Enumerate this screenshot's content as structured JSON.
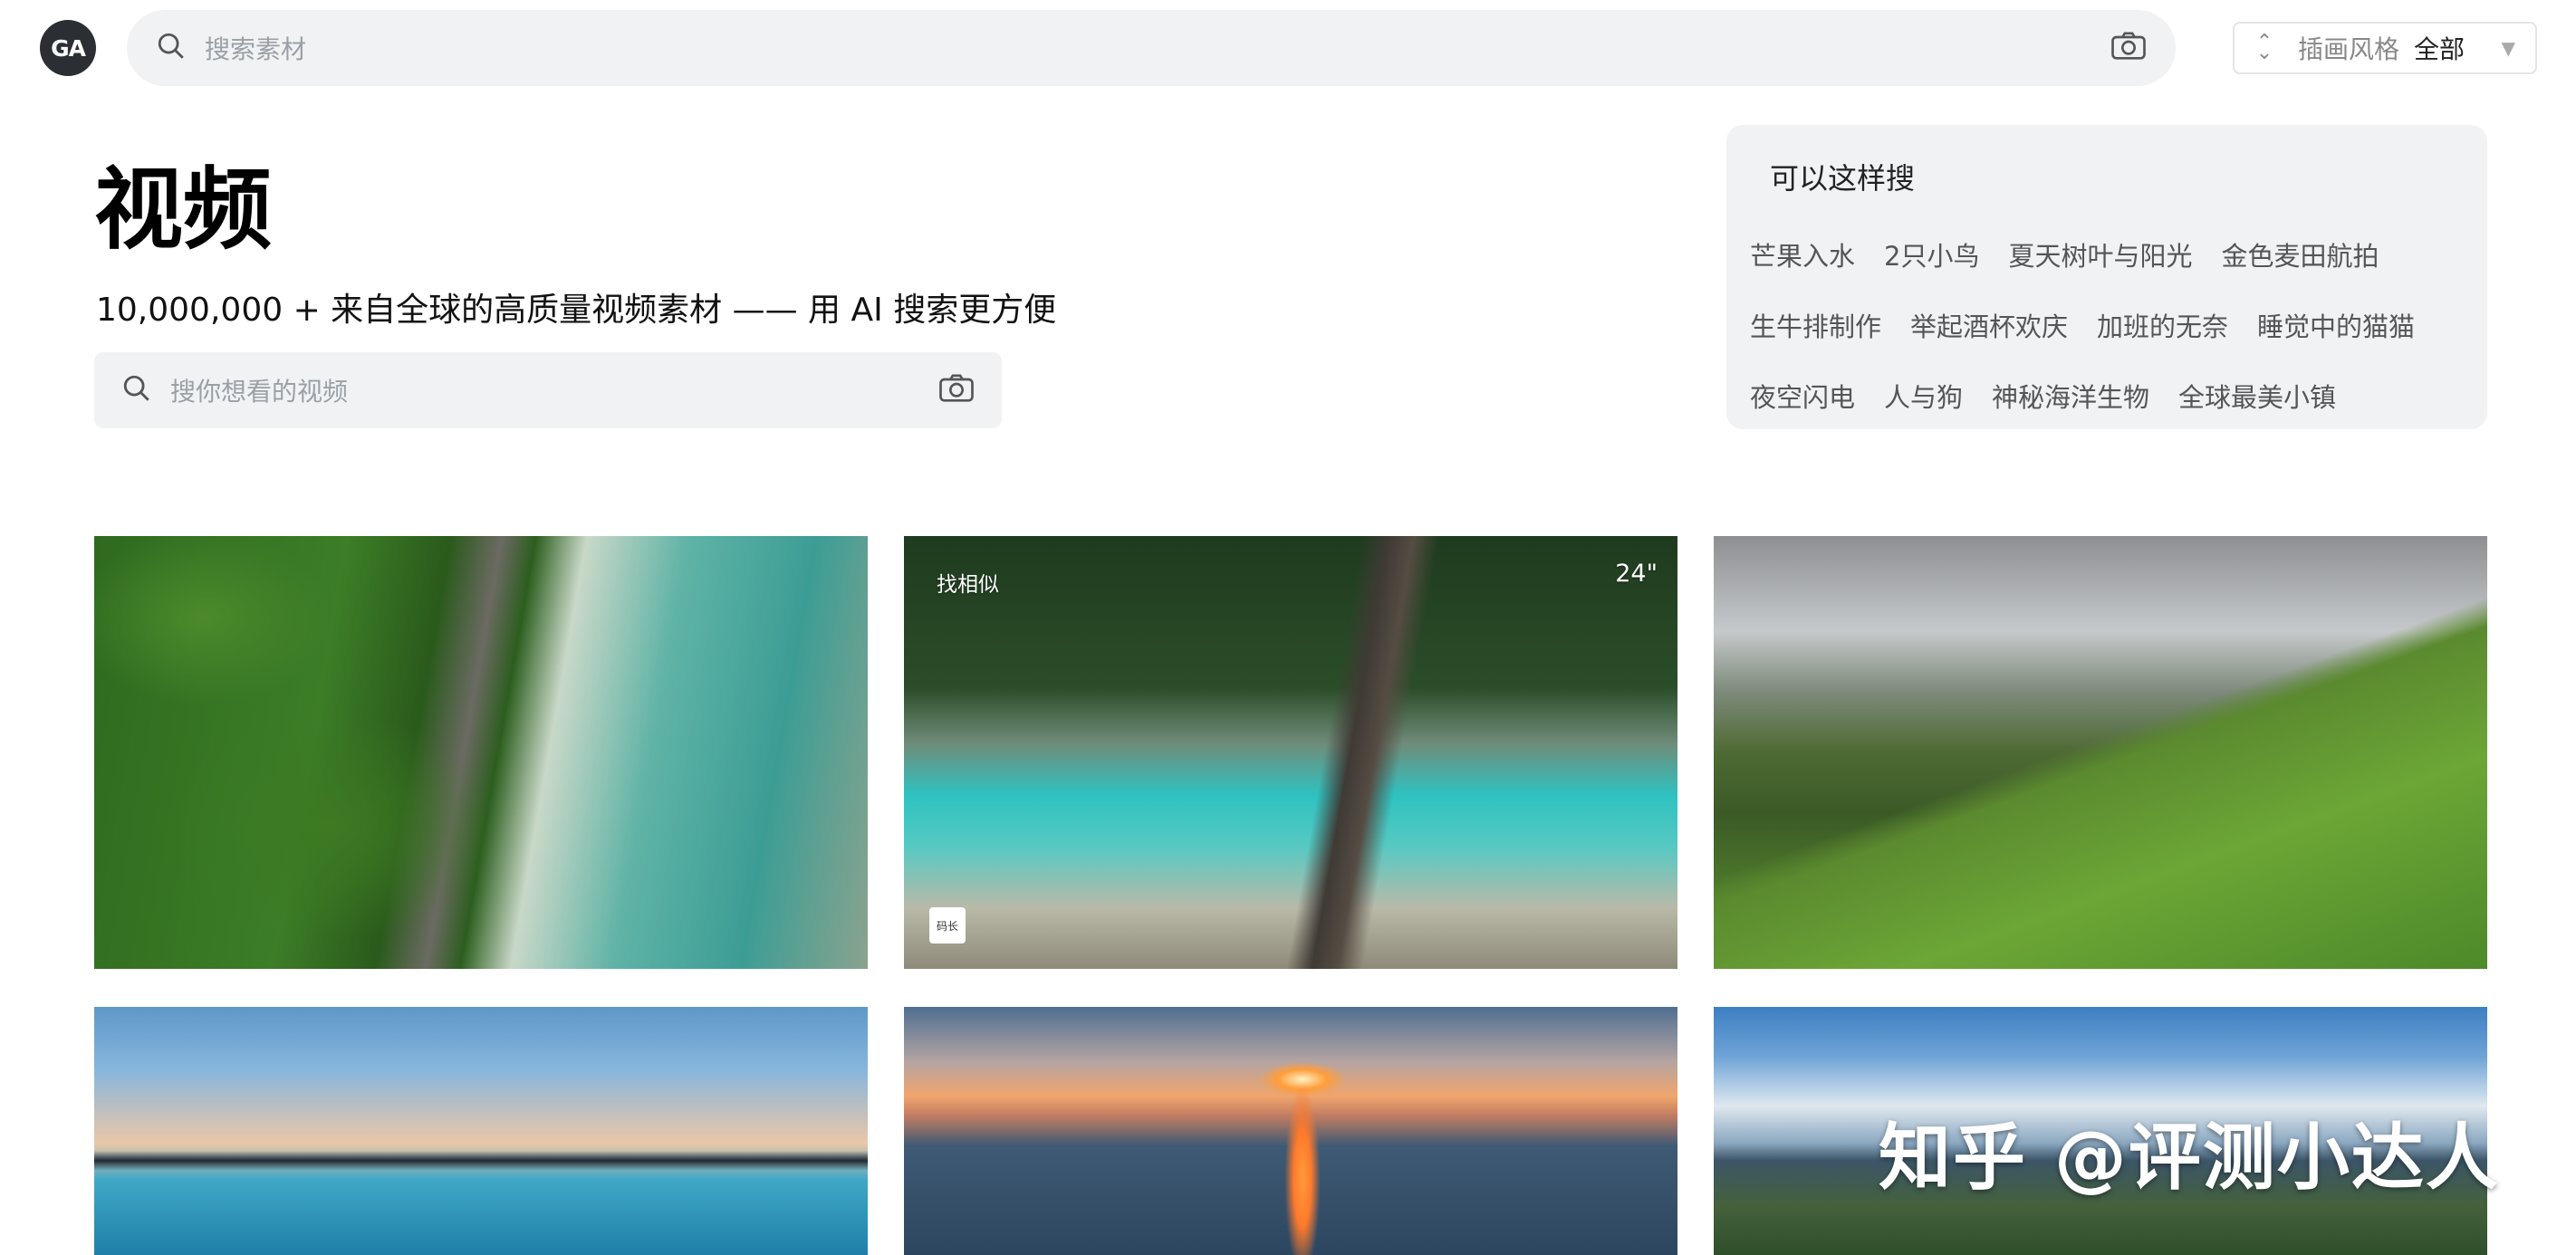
{
  "logo": {
    "text": "GA"
  },
  "top_search": {
    "placeholder": "搜索素材"
  },
  "style_filter": {
    "label": "插画风格",
    "value": "全部"
  },
  "hero": {
    "title": "视频",
    "subtitle": "10,000,000 + 来自全球的高质量视频素材 —— 用 AI 搜索更方便",
    "search_placeholder": "搜你想看的视频"
  },
  "suggestions": {
    "heading": "可以这样搜",
    "rows": [
      [
        "芒果入水",
        "2只小鸟",
        "夏天树叶与阳光",
        "金色麦田航拍"
      ],
      [
        "生牛排制作",
        "举起酒杯欢庆",
        "加班的无奈",
        "睡觉中的猫猫"
      ],
      [
        "夜空闪电",
        "人与狗",
        "神秘海洋生物",
        "全球最美小镇"
      ]
    ]
  },
  "videos": {
    "hovered_badge": "找相似",
    "hovered_duration": "24\"",
    "mini_label": "码长"
  },
  "watermark": "知乎 @评测小达人",
  "colors": {
    "accent_bg": "#f1f2f4",
    "logo_bg": "#2b2f33"
  }
}
